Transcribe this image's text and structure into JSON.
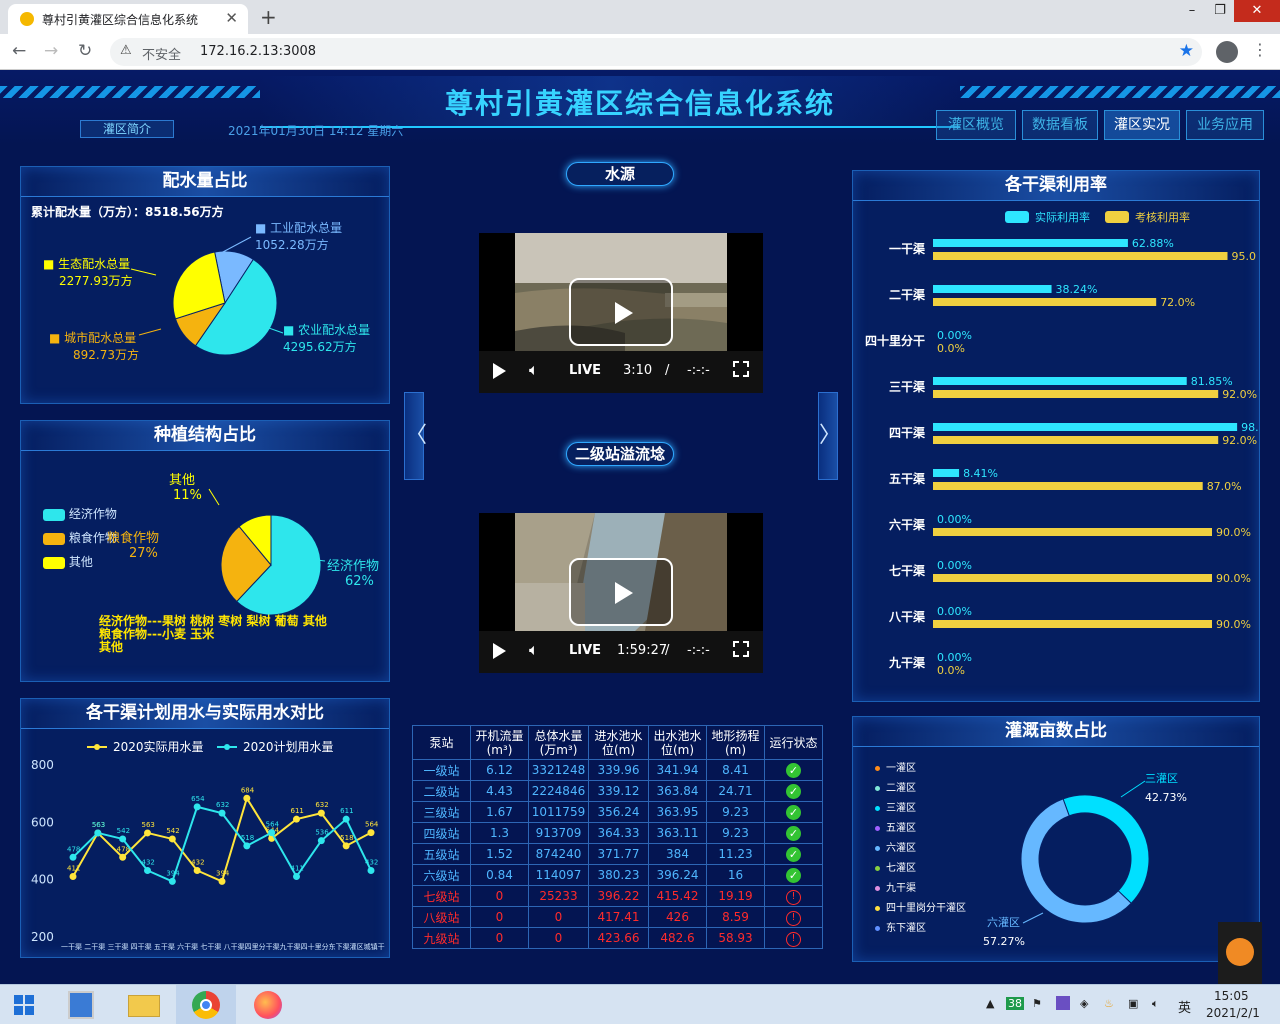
{
  "browser": {
    "tab_title": "尊村引黄灌区综合信息化系统",
    "tab_close": "✕",
    "new_tab": "+",
    "insecure": "不安全",
    "url": "172.16.2.13:3008",
    "window_controls": [
      "–",
      "❐",
      "✕"
    ]
  },
  "header": {
    "title": "尊村引黄灌区综合信息化系统",
    "intro_button": "灌区简介",
    "datetime": "2021年01月30日 14:12 星期六",
    "nav": [
      "灌区概览",
      "数据看板",
      "灌区实况",
      "业务应用"
    ],
    "active_nav": "灌区实况"
  },
  "water_allocation": {
    "title": "配水量占比",
    "total_label": "累计配水量（万方）：8518.56万方",
    "items": [
      {
        "name": "工业配水总量",
        "value": "1052.28万方",
        "share": 1052.28,
        "color": "#7ab9ff"
      },
      {
        "name": "农业配水总量",
        "value": "4295.62万方",
        "share": 4295.62,
        "color": "#2ee6ec"
      },
      {
        "name": "城市配水总量",
        "value": "892.73万方",
        "share": 892.73,
        "color": "#f5b30f"
      },
      {
        "name": "生态配水总量",
        "value": "2277.93万方",
        "share": 2277.93,
        "color": "#ffff00"
      }
    ]
  },
  "planting": {
    "title": "种植结构占比",
    "legend": [
      {
        "name": "经济作物",
        "color": "#2ee6ec"
      },
      {
        "name": "粮食作物",
        "color": "#f5b30f"
      },
      {
        "name": "其他",
        "color": "#ffff00"
      }
    ],
    "slices": [
      {
        "name": "经济作物",
        "pct": "62%",
        "value": 62
      },
      {
        "name": "粮食作物",
        "pct": "27%",
        "value": 27
      },
      {
        "name": "其他",
        "pct": "11%",
        "value": 11
      }
    ],
    "notes": [
      "经济作物---果树 桃树 枣树 梨树 葡萄 其他",
      "粮食作物---小麦 玉米",
      "其他"
    ]
  },
  "water_compare": {
    "title": "各干渠计划用水与实际用水对比",
    "chart_data": {
      "type": "line",
      "x": [
        "一干渠",
        "二干渠",
        "三干渠",
        "四干渠",
        "五干渠",
        "六干渠",
        "七干渠",
        "八干渠",
        "四十里分干渠",
        "九干渠",
        "四十里分干渠",
        "东下渠",
        "灌区",
        "城镇",
        "干渠"
      ],
      "x_label_text": "一干渠 二干渠 三干渠 四干渠 五干渠 六干渠 七干渠 八干渠四里分干渠九干渠四十里分东下渠灌区城镇干",
      "ylim": [
        200,
        800
      ],
      "yticks": [
        200,
        400,
        600,
        800
      ],
      "series": [
        {
          "name": "2020实际用水量",
          "color": "#ffe53b",
          "values": [
            411,
            563,
            478,
            563,
            542,
            432,
            394,
            684,
            544,
            611,
            632,
            518,
            564
          ]
        },
        {
          "name": "2020计划用水量",
          "color": "#2ee6ec",
          "values": [
            478,
            563,
            542,
            432,
            394,
            654,
            632,
            518,
            564,
            411,
            536,
            611,
            432
          ]
        }
      ]
    }
  },
  "water_source": {
    "title": "水源",
    "videos": [
      {
        "time": "3:10",
        "live": "LIVE",
        "sep": "/",
        "dur": "-:-:-"
      },
      {
        "time": "1:59:27",
        "live": "LIVE",
        "sep": "/",
        "dur": "-:-:-"
      }
    ],
    "second_title": "二级站溢流埝",
    "prev": "〈",
    "next": "〉"
  },
  "pump_table": {
    "headers": [
      "泵站",
      "开机流量\n(m³)",
      "总体水量\n(万m³)",
      "进水池水\n位(m)",
      "出水池水\n位(m)",
      "地形扬程\n(m)",
      "运行状态"
    ],
    "rows": [
      [
        "一级站",
        "6.12",
        "3321248",
        "339.96",
        "341.94",
        "8.41",
        "ok"
      ],
      [
        "二级站",
        "4.43",
        "2224846",
        "339.12",
        "363.84",
        "24.71",
        "ok"
      ],
      [
        "三级站",
        "1.67",
        "1011759",
        "356.24",
        "363.95",
        "9.23",
        "ok"
      ],
      [
        "四级站",
        "1.3",
        "913709",
        "364.33",
        "363.11",
        "9.23",
        "ok"
      ],
      [
        "五级站",
        "1.52",
        "874240",
        "371.77",
        "384",
        "11.23",
        "ok"
      ],
      [
        "六级站",
        "0.84",
        "114097",
        "380.23",
        "396.24",
        "16",
        "ok"
      ],
      [
        "七级站",
        "0",
        "25233",
        "396.22",
        "415.42",
        "19.19",
        "bad"
      ],
      [
        "八级站",
        "0",
        "0",
        "417.41",
        "426",
        "8.59",
        "bad"
      ],
      [
        "九级站",
        "0",
        "0",
        "423.66",
        "482.6",
        "58.93",
        "bad"
      ]
    ]
  },
  "canal_usage": {
    "title": "各干渠利用率",
    "legend": [
      {
        "name": "实际利用率",
        "color": "#2ee6ff"
      },
      {
        "name": "考核利用率",
        "color": "#f0d040"
      }
    ],
    "chart_data": {
      "type": "bar",
      "categories": [
        "一干渠",
        "二干渠",
        "四十里分干",
        "三干渠",
        "四干渠",
        "五干渠",
        "六干渠",
        "七干渠",
        "八干渠",
        "九干渠"
      ],
      "series": [
        {
          "name": "实际利用率",
          "values": [
            62.88,
            38.24,
            0,
            81.85,
            98.1,
            8.41,
            0,
            0,
            0,
            0
          ],
          "labels": [
            "62.88%",
            "38.24%",
            "0.00%",
            "81.85%",
            "98.",
            "8.41%",
            "0.00%",
            "0.00%",
            "0.00%",
            "0.00%"
          ]
        },
        {
          "name": "考核利用率",
          "values": [
            95.0,
            72.0,
            0,
            92.0,
            92.0,
            87.0,
            90.0,
            90.0,
            90.0,
            0
          ],
          "labels": [
            "95.0",
            "72.0%",
            "0.0%",
            "92.0%",
            "92.0%",
            "87.0%",
            "90.0%",
            "90.0%",
            "90.0%",
            "0.0%"
          ]
        }
      ],
      "xlim": [
        0,
        100
      ]
    }
  },
  "irrigation_area": {
    "title": "灌溉亩数占比",
    "legend": [
      {
        "name": "一灌区",
        "color": "#ff8c1a"
      },
      {
        "name": "二灌区",
        "color": "#7fe8d8"
      },
      {
        "name": "三灌区",
        "color": "#00e0ff"
      },
      {
        "name": "五灌区",
        "color": "#a060ff"
      },
      {
        "name": "六灌区",
        "color": "#66b8ff"
      },
      {
        "name": "七灌区",
        "color": "#88d040"
      },
      {
        "name": "九干渠",
        "color": "#e090e0"
      },
      {
        "name": "四十里岗分干灌区",
        "color": "#ffe040"
      },
      {
        "name": "东下灌区",
        "color": "#6090ff"
      }
    ],
    "chart_data": {
      "type": "pie",
      "slices": [
        {
          "name": "三灌区",
          "value": 42.73,
          "label": "42.73%",
          "color": "#00e0ff"
        },
        {
          "name": "六灌区",
          "value": 57.27,
          "label": "57.27%",
          "color": "#66b8ff"
        }
      ]
    }
  },
  "taskbar": {
    "time": "15:05",
    "date": "2021/2/1",
    "ime": "英",
    "badge": "38"
  }
}
